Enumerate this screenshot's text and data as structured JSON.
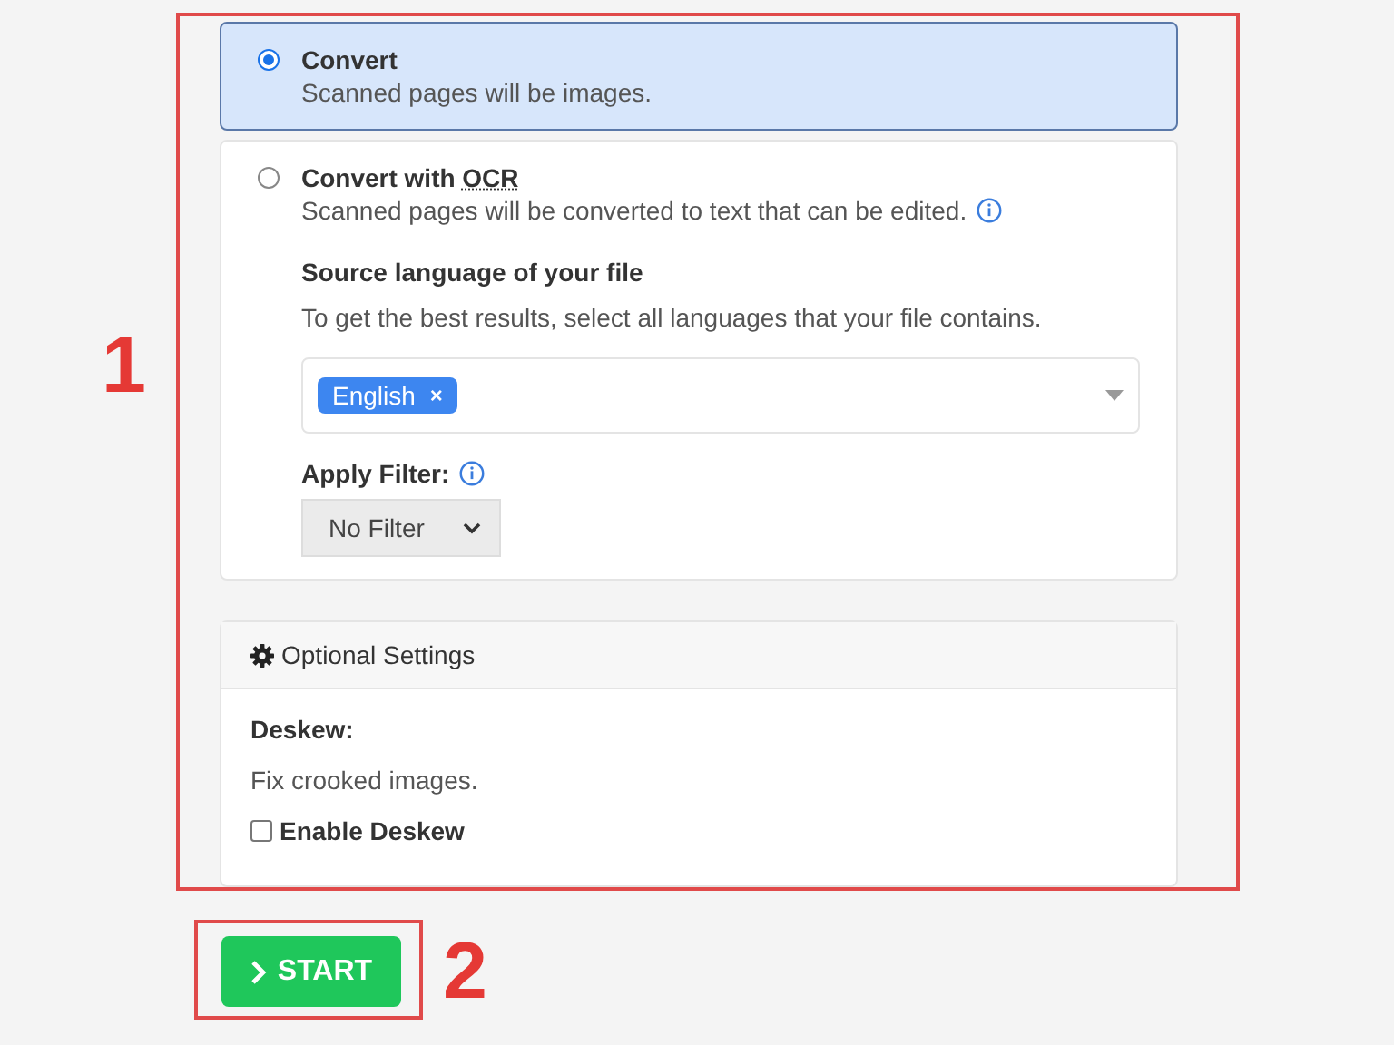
{
  "options": [
    {
      "title": "Convert",
      "description": "Scanned pages will be images.",
      "selected": true
    },
    {
      "title": "Convert with",
      "abbr": "OCR",
      "description": "Scanned pages will be converted to text that can be edited.",
      "selected": false,
      "language": {
        "heading": "Source language of your file",
        "hint": "To get the best results, select all languages that your file contains.",
        "tags": [
          {
            "label": "English",
            "remove": "×"
          }
        ]
      },
      "filter": {
        "label": "Apply Filter:",
        "value": "No Filter"
      }
    }
  ],
  "optional_settings": {
    "title": "Optional Settings",
    "deskew_label": "Deskew:",
    "deskew_description": "Fix crooked images.",
    "checkbox": {
      "label": "Enable Deskew",
      "checked": false
    }
  },
  "start_button": "START",
  "annotations": [
    {
      "number": "1"
    },
    {
      "number": "2"
    }
  ]
}
